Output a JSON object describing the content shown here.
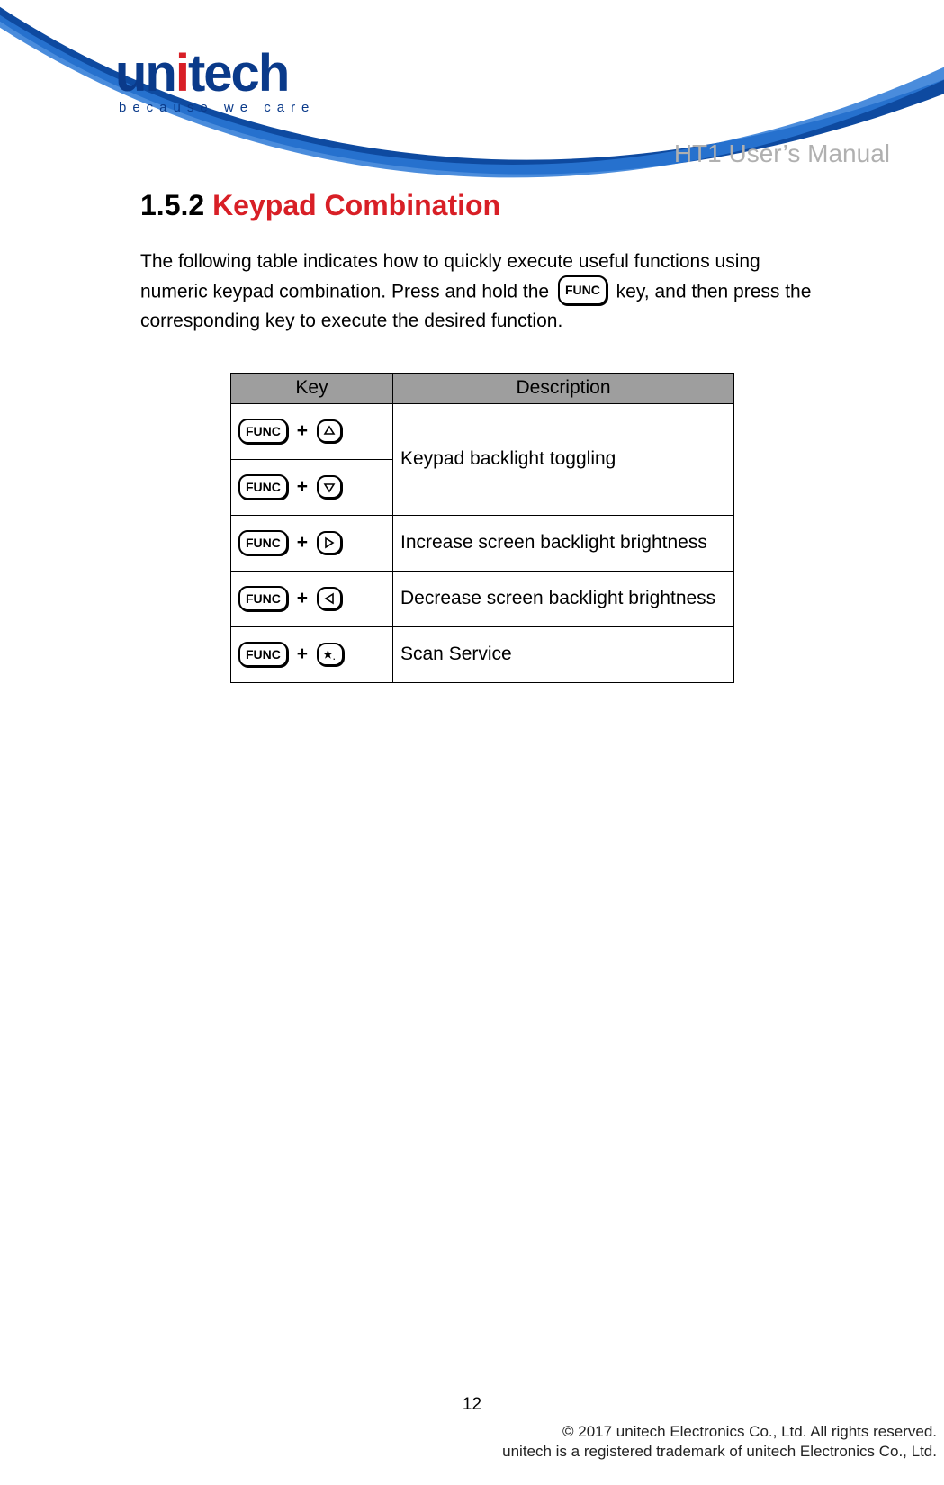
{
  "brand": {
    "name_pre": "un",
    "name_dot": "i",
    "name_post": "tech",
    "tagline": "because we care"
  },
  "header": {
    "manual_title": "HT1 User’s Manual"
  },
  "section": {
    "number": "1.5.2",
    "title": "Keypad Combination",
    "intro_pre": "The following table indicates how to quickly execute useful functions using numeric keypad combination. Press and hold the ",
    "intro_post": " key, and then press the corresponding key to execute the desired function.",
    "func_label": "FUNC"
  },
  "table": {
    "headers": {
      "key": "Key",
      "desc": "Description"
    },
    "rows": [
      {
        "combo": [
          "FUNC",
          "+",
          "up"
        ],
        "desc": "Keypad backlight toggling",
        "merge_with_next": true
      },
      {
        "combo": [
          "FUNC",
          "+",
          "down"
        ],
        "desc": ""
      },
      {
        "combo": [
          "FUNC",
          "+",
          "right"
        ],
        "desc": "Increase screen backlight brightness"
      },
      {
        "combo": [
          "FUNC",
          "+",
          "left"
        ],
        "desc": "Decrease screen backlight brightness"
      },
      {
        "combo": [
          "FUNC",
          "+",
          "star"
        ],
        "desc": "Scan Service"
      }
    ]
  },
  "footer": {
    "page_number": "12",
    "copyright_line1": "© 2017 unitech Electronics Co., Ltd. All rights reserved.",
    "copyright_line2": "unitech is a registered trademark of unitech Electronics Co., Ltd."
  }
}
